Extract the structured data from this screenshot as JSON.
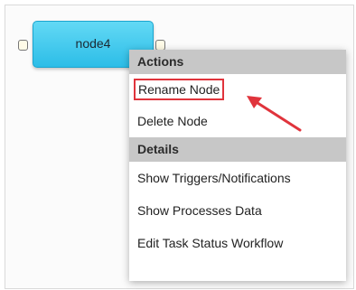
{
  "node": {
    "label": "node4",
    "color": "#2cbde7"
  },
  "context_menu": {
    "sections": [
      {
        "header": "Actions",
        "items": [
          "Rename Node",
          "Delete Node"
        ]
      },
      {
        "header": "Details",
        "items": [
          "Show Triggers/Notifications",
          "Show Processes Data",
          "Edit Task Status Workflow"
        ]
      }
    ],
    "highlighted_item": "Rename Node",
    "highlight_color": "#e0343c",
    "header_background": "#c7c7c7"
  }
}
